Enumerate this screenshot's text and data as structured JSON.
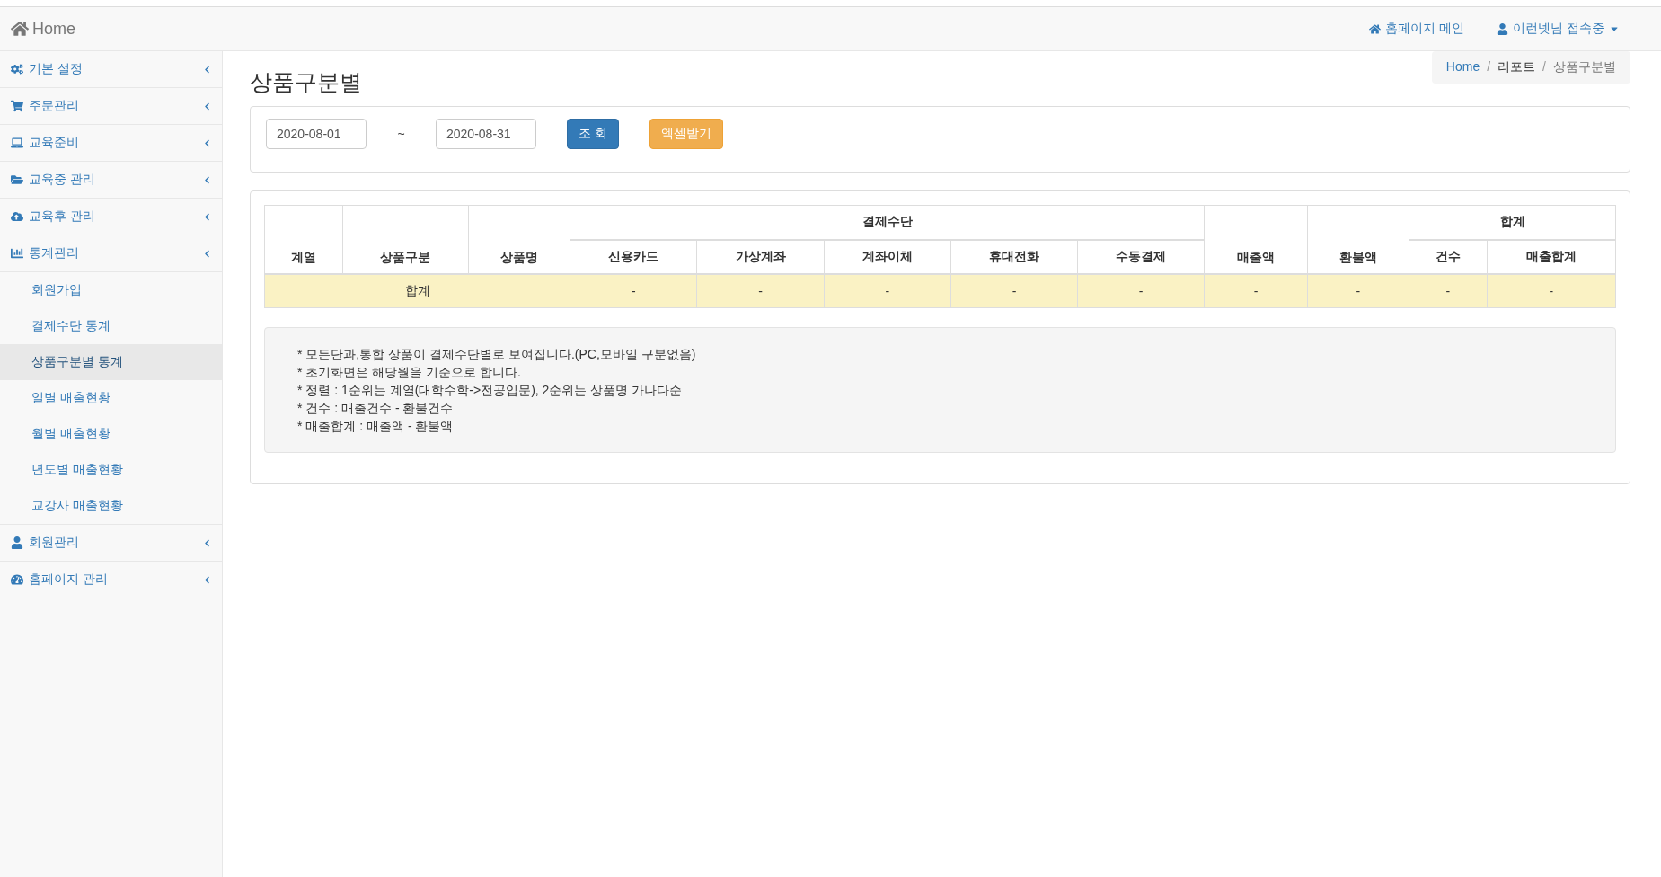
{
  "navbar": {
    "brand": "Home",
    "links": [
      {
        "label": "홈페이지 메인",
        "dropdown": false
      },
      {
        "label": "이런넷님 접속중",
        "dropdown": true
      }
    ]
  },
  "sidebar": {
    "items": [
      {
        "label": "기본 설정"
      },
      {
        "label": "주문관리"
      },
      {
        "label": "교육준비"
      },
      {
        "label": "교육중 관리"
      },
      {
        "label": "교육후 관리"
      },
      {
        "label": "통계관리",
        "children": [
          {
            "label": "회원가입",
            "selected": false
          },
          {
            "label": "결제수단 통계",
            "selected": false
          },
          {
            "label": "상품구분별 통계",
            "selected": true
          },
          {
            "label": "일별 매출현황",
            "selected": false
          },
          {
            "label": "월별 매출현황",
            "selected": false
          },
          {
            "label": "년도별 매출현황",
            "selected": false
          },
          {
            "label": "교강사 매출현황",
            "selected": false
          }
        ]
      },
      {
        "label": "회원관리"
      },
      {
        "label": "홈페이지 관리"
      }
    ]
  },
  "page_title": "상품구분별",
  "breadcrumb_separator": "/",
  "breadcrumb": [
    {
      "label": "Home",
      "kind": "link"
    },
    {
      "label": "리포트",
      "kind": "text"
    },
    {
      "label": "상품구분별",
      "kind": "active"
    }
  ],
  "filter": {
    "start_date": "2020-08-01",
    "separator": "~",
    "end_date": "2020-08-31",
    "buttons": [
      {
        "label": "조 회",
        "kind": "primary"
      },
      {
        "label": "엑셀받기",
        "kind": "warning"
      }
    ]
  },
  "table": {
    "columns": [
      {
        "label": "계열"
      },
      {
        "label": "상품구분"
      },
      {
        "label": "상품명"
      },
      {
        "label": "결제수단",
        "columns": [
          "신용카드",
          "가상계좌",
          "계좌이체",
          "휴대전화",
          "수동결제"
        ]
      },
      {
        "label": "매출액"
      },
      {
        "label": "환불액"
      },
      {
        "label": "합계",
        "columns": [
          "건수",
          "매출합계"
        ]
      }
    ],
    "total_row": {
      "label": "합계",
      "values": [
        "-",
        "-",
        "-",
        "-",
        "-",
        "-",
        "-",
        "-",
        "-"
      ]
    }
  },
  "notes": [
    "* 모든단과,통합 상품이 결제수단별로 보여집니다.(PC,모바일 구분없음)",
    "* 초기화면은 해당월을 기준으로 합니다.",
    "* 정렬 : 1순위는 계열(대학수학->전공입문), 2순위는 상품명 가나다순",
    "* 건수 : 매출건수 - 환불건수",
    "* 매출합계 : 매출액 - 환불액"
  ]
}
